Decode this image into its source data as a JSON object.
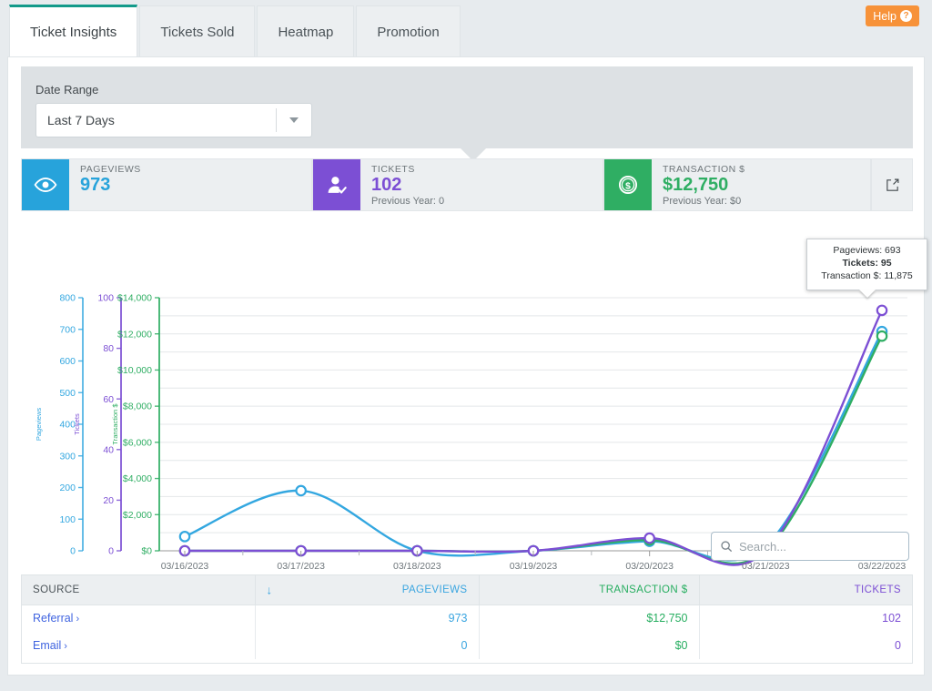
{
  "tabs": [
    {
      "label": "Ticket Insights",
      "active": true
    },
    {
      "label": "Tickets Sold",
      "active": false
    },
    {
      "label": "Heatmap",
      "active": false
    },
    {
      "label": "Promotion",
      "active": false
    }
  ],
  "help": {
    "label": "Help",
    "glyph": "?"
  },
  "date_range": {
    "label": "Date Range",
    "value": "Last 7 Days"
  },
  "kpis": [
    {
      "icon": "eye-icon",
      "title": "PAGEVIEWS",
      "value": "973",
      "previous": "",
      "color": "#27a3db",
      "value_color": "#27a3db"
    },
    {
      "icon": "user-check-icon",
      "title": "TICKETS",
      "value": "102",
      "previous": "Previous Year: 0",
      "color": "#7c4fd4",
      "value_color": "#7c4fd4"
    },
    {
      "icon": "dollar-coin-icon",
      "title": "TRANSACTION $",
      "value": "$12,750",
      "previous": "Previous Year: $0",
      "color": "#2fae63",
      "value_color": "#2fae63"
    }
  ],
  "tooltip": {
    "pageviews": "Pageviews: 693",
    "tickets": "Tickets: 95",
    "transaction": "Transaction $: 11,875"
  },
  "search": {
    "placeholder": "Search...",
    "value": ""
  },
  "table": {
    "columns": [
      "SOURCE",
      "PAGEVIEWS",
      "TRANSACTION $",
      "TICKETS"
    ],
    "sort_indicator": "↓",
    "rows": [
      {
        "source": "Referral",
        "chevron": "›",
        "pageviews": "973",
        "transaction": "$12,750",
        "tickets": "102"
      },
      {
        "source": "Email",
        "chevron": "›",
        "pageviews": "0",
        "transaction": "$0",
        "tickets": "0"
      }
    ]
  },
  "chart_data": {
    "type": "line",
    "title": "",
    "x": [
      "03/16/2023",
      "03/17/2023",
      "03/18/2023",
      "03/19/2023",
      "03/20/2023",
      "03/21/2023",
      "03/22/2023"
    ],
    "xlabel": "",
    "grid": true,
    "legend": "none",
    "series": [
      {
        "name": "Pageviews",
        "color": "#33a7e0",
        "axis": "left-1",
        "ylabel": "Pageviews",
        "ylim": [
          0,
          800
        ],
        "yticks": [
          0,
          100,
          200,
          300,
          400,
          500,
          600,
          700,
          800
        ],
        "values": [
          45,
          190,
          0,
          0,
          30,
          15,
          693
        ]
      },
      {
        "name": "Tickets",
        "color": "#7c4fd4",
        "axis": "left-2",
        "ylabel": "Tickets",
        "ylim": [
          0,
          100
        ],
        "yticks": [
          0,
          20,
          40,
          60,
          80,
          100
        ],
        "values": [
          0,
          0,
          0,
          0,
          5,
          0,
          95
        ]
      },
      {
        "name": "Transaction $",
        "color": "#2fae63",
        "axis": "left-3",
        "ylabel": "Transaction $",
        "ylim": [
          0,
          14000
        ],
        "yticks": [
          0,
          2000,
          4000,
          6000,
          8000,
          10000,
          12000,
          14000
        ],
        "ytick_labels": [
          "$0",
          "$2,000",
          "$4,000",
          "$6,000",
          "$8,000",
          "$10,000",
          "$12,000",
          "$14,000"
        ],
        "values": [
          0,
          0,
          0,
          0,
          600,
          0,
          11875
        ]
      }
    ]
  }
}
